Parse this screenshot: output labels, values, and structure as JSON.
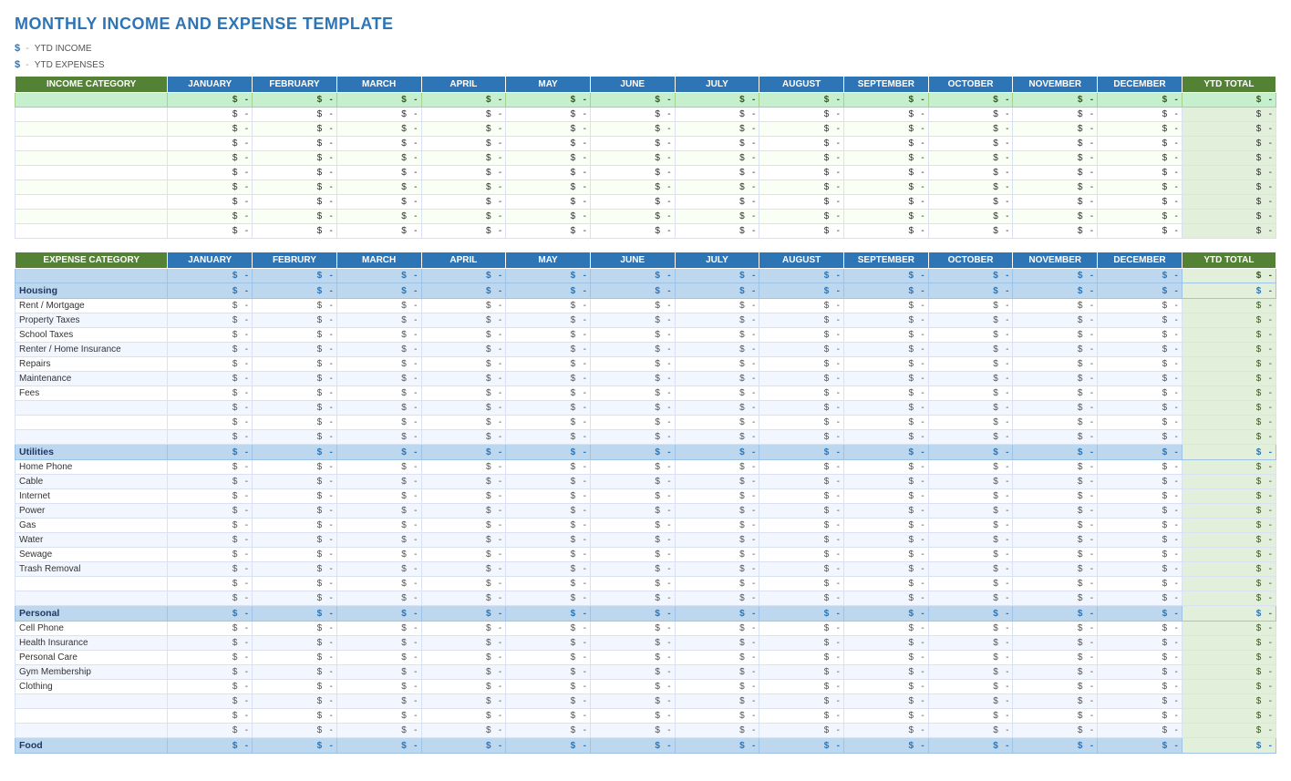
{
  "title": "MONTHLY INCOME AND EXPENSE TEMPLATE",
  "ytd_income_label": "YTD INCOME",
  "ytd_expenses_label": "YTD EXPENSES",
  "dollar_sign": "$",
  "dash": "-",
  "months": [
    "JANUARY",
    "FEBRUARY",
    "MARCH",
    "APRIL",
    "MAY",
    "JUNE",
    "JULY",
    "AUGUST",
    "SEPTEMBER",
    "OCTOBER",
    "NOVEMBER",
    "DECEMBER"
  ],
  "months_expense": [
    "JANUARY",
    "FEBRURY",
    "MARCH",
    "APRIL",
    "MAY",
    "JUNE",
    "JULY",
    "AUGUST",
    "SEPTEMBER",
    "OCTOBER",
    "NOVEMBER",
    "DECEMBER"
  ],
  "ytd_total": "YTD TOTAL",
  "income_category_label": "INCOME CATEGORY",
  "expense_category_label": "EXPENSE CATEGORY",
  "income_rows": 9,
  "expense_categories": [
    {
      "name": "Housing",
      "items": [
        "Rent / Mortgage",
        "Property Taxes",
        "School Taxes",
        "Renter / Home Insurance",
        "Repairs",
        "Maintenance",
        "Fees",
        "",
        "",
        ""
      ]
    },
    {
      "name": "Utilities",
      "items": [
        "Home Phone",
        "Cable",
        "Internet",
        "Power",
        "Gas",
        "Water",
        "Sewage",
        "Trash Removal",
        "",
        ""
      ]
    },
    {
      "name": "Personal",
      "items": [
        "Cell Phone",
        "Health Insurance",
        "Personal Care",
        "Gym Membership",
        "Clothing",
        "",
        "",
        ""
      ]
    },
    {
      "name": "Food",
      "items": []
    }
  ]
}
